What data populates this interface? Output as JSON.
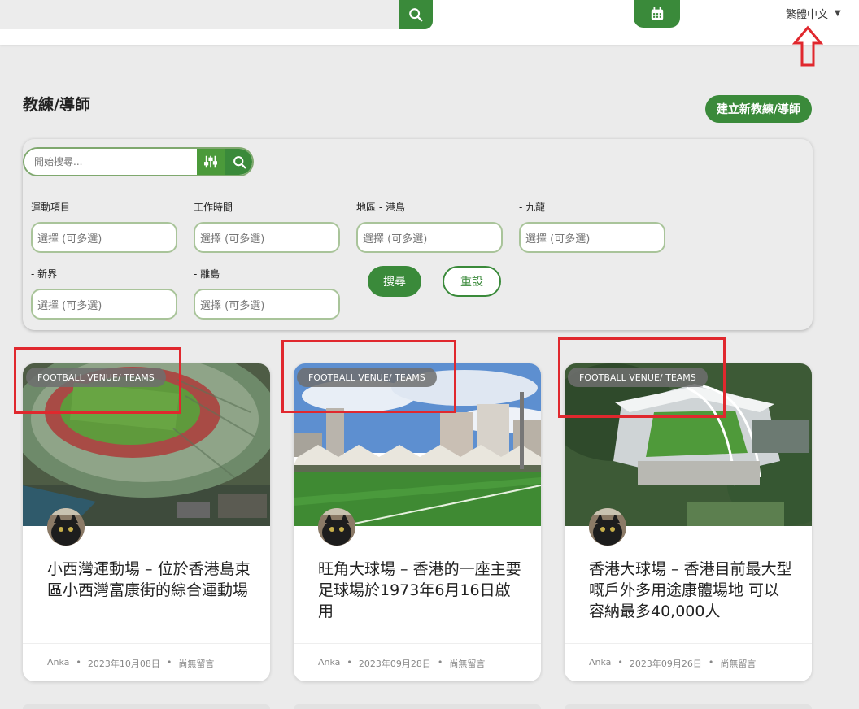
{
  "topbar": {
    "language": "繁體中文",
    "language_caret": "▼"
  },
  "page": {
    "title": "教練/導師",
    "create_button": "建立新教練/導師"
  },
  "filters": {
    "search_placeholder": "開始搜尋...",
    "fields": [
      {
        "label": "運動項目",
        "placeholder": "選擇 (可多選)"
      },
      {
        "label": "工作時間",
        "placeholder": "選擇 (可多選)"
      },
      {
        "label": "地區 - 港島",
        "placeholder": "選擇 (可多選)"
      },
      {
        "label": "- 九龍",
        "placeholder": "選擇 (可多選)"
      },
      {
        "label": "- 新界",
        "placeholder": "選擇 (可多選)"
      },
      {
        "label": "- 離島",
        "placeholder": "選擇 (可多選)"
      }
    ],
    "search_button": "搜尋",
    "reset_button": "重設"
  },
  "cards": [
    {
      "tag": "FOOTBALL VENUE/ TEAMS",
      "title": "小西灣運動場 – 位於香港島東區小西灣富康街的綜合運動場",
      "author": "Anka",
      "date": "2023年10月08日",
      "comments": "尚無留言",
      "sep": "•"
    },
    {
      "tag": "FOOTBALL VENUE/ TEAMS",
      "title": "旺角大球場 – 香港的一座主要足球場於1973年6月16日啟用",
      "author": "Anka",
      "date": "2023年09月28日",
      "comments": "尚無留言",
      "sep": "•"
    },
    {
      "tag": "FOOTBALL VENUE/ TEAMS",
      "title": "香港大球場 – 香港目前最大型嘅戶外多用途康體場地 可以容納最多40,000人",
      "author": "Anka",
      "date": "2023年09月26日",
      "comments": "尚無留言",
      "sep": "•"
    }
  ],
  "colors": {
    "accent_green": "#3a8a3a",
    "annotation_red": "#e0282e"
  }
}
